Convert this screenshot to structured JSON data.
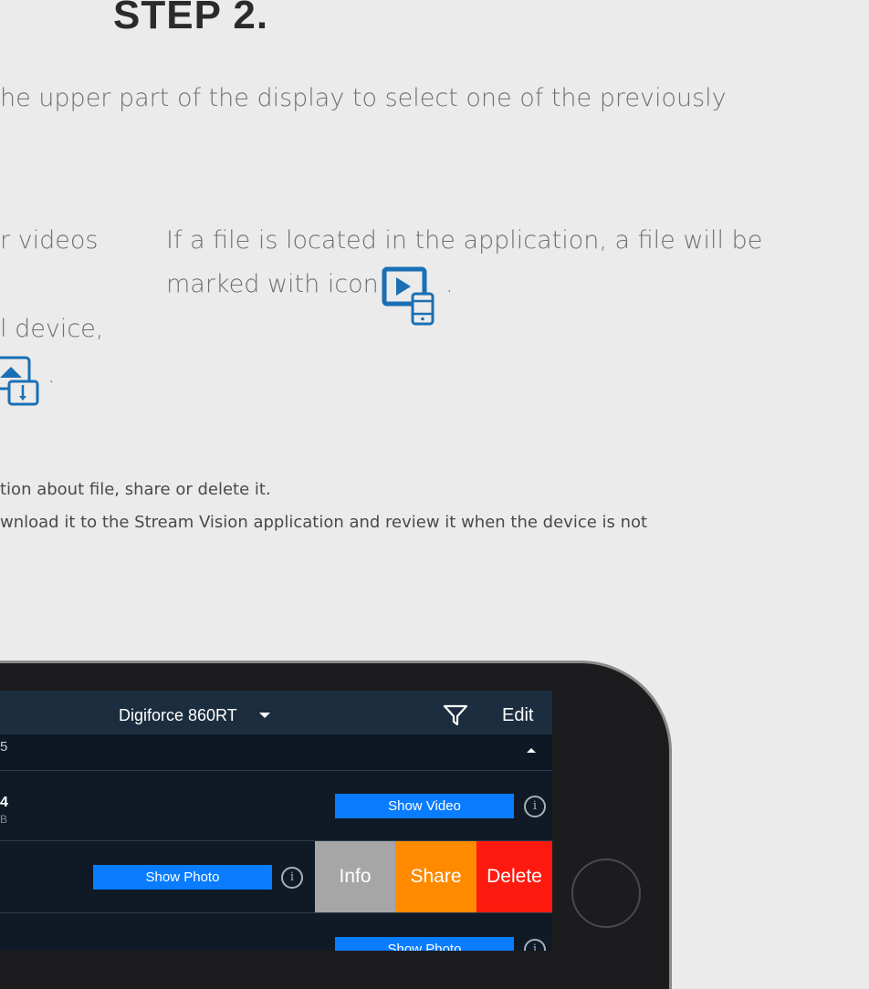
{
  "heading": "STEP 2.",
  "lines": {
    "intro": "he upper part of the display to select one of the previously",
    "left_1": "r videos",
    "right_1": "If a file is located in the application, a file will be",
    "right_2": "marked with icon",
    "right_2_end": ".",
    "left_2": "l device,",
    "left_3_end": ".",
    "small_1": "tion about file, share or delete it.",
    "small_2": "wnload it to the Stream Vision application and review it when the device is not"
  },
  "phone": {
    "device_name": "Digiforce 860RT",
    "edit_label": "Edit",
    "row1_left": "5",
    "row2_left_top": "4",
    "row2_left_bottom": "B",
    "show_video": "Show Video",
    "show_photo": "Show Photo",
    "show_photo_2": "Show Photo",
    "info_label": "Info",
    "share_label": "Share",
    "delete_label": "Delete",
    "info_glyph": "i"
  },
  "colors": {
    "accent": "#0a7cff",
    "share": "#ff8a00",
    "delete": "#ff1a10",
    "info": "#a6a6a6",
    "icon_blue": "#1a6fb5"
  },
  "icons": [
    "video-on-phone-icon",
    "photo-download-icon",
    "filter-icon",
    "info-circle-icon",
    "chevron-down-icon",
    "caret-up-icon"
  ]
}
